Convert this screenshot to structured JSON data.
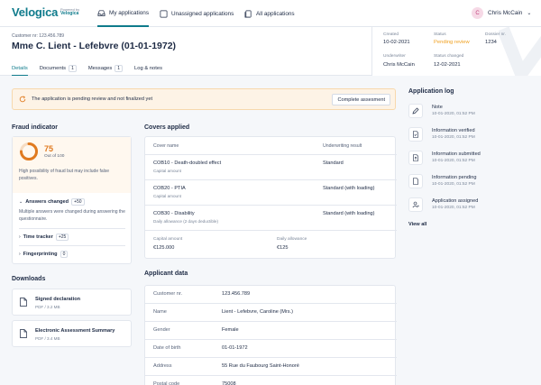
{
  "nav": {
    "brand": "Velogica",
    "powered_by": "Powered by",
    "powered_brand": "Velogica",
    "tabs": [
      {
        "label": "My applications",
        "active": true
      },
      {
        "label": "Unassigned applications",
        "active": false
      },
      {
        "label": "All applications",
        "active": false
      }
    ],
    "user": {
      "initial": "C",
      "name": "Chris McCain"
    }
  },
  "header": {
    "customer_nr": "Customer nr: 123.456.789",
    "title": "Mme C. Lient - Lefebvre (01-01-1972)",
    "tabs": [
      {
        "label": "Details",
        "badge": null,
        "active": true
      },
      {
        "label": "Documents",
        "badge": "1",
        "active": false
      },
      {
        "label": "Messages",
        "badge": "1",
        "active": false
      },
      {
        "label": "Log & notes",
        "badge": null,
        "active": false
      }
    ],
    "meta": {
      "created_label": "Created",
      "created_value": "10-02-2021",
      "status_label": "Status",
      "status_value": "Pending review",
      "dossier_label": "Dossier nr.",
      "dossier_value": "1234",
      "underwriter_label": "Underwriter",
      "underwriter_value": "Chris McCain",
      "status_changed_label": "Status changed",
      "status_changed_value": "12-02-2021"
    }
  },
  "banner": {
    "text": "The application is pending review and not finalized yet",
    "button": "Complete assesment"
  },
  "fraud": {
    "title": "Fraud indicator",
    "score": "75",
    "score_fraction": 0.75,
    "out_of": "Out of 100",
    "description": "High possibility of fraud but may include false positives.",
    "answers_changed": {
      "label": "Answers changed",
      "badge": "+50",
      "description": "Multiple answers were changed during answering the questionnaire."
    },
    "time_tracker": {
      "label": "Time tracker",
      "badge": "+25"
    },
    "fingerprinting": {
      "label": "Fingerprinting",
      "badge": "0"
    }
  },
  "downloads": {
    "title": "Downloads",
    "items": [
      {
        "name": "Signed declaration",
        "size": "PDF / 3.2 MB"
      },
      {
        "name": "Electronic Assessment Summary",
        "size": "PDF / 3.4 MB"
      }
    ]
  },
  "covers": {
    "title": "Covers applied",
    "col_name": "Cover name",
    "col_result": "Underwriting result",
    "rows": [
      {
        "name": "COB10 - Death-doubled effect",
        "detail": "Capital amount",
        "result": "Standard"
      },
      {
        "name": "COB20 - PTIA",
        "detail": "Capital amount",
        "result": "Standard (with loading)"
      },
      {
        "name": "COB30 - Disability",
        "detail": "Daily allowance (2 days deductible)",
        "result": "Standard (with loading)"
      }
    ],
    "capital_label": "Capital amount",
    "capital_value": "€125.000",
    "daily_label": "Daily allowance",
    "daily_value": "€125"
  },
  "applicant": {
    "title": "Applicant data",
    "rows": [
      {
        "key": "Customer nr.",
        "value": "123.456.789"
      },
      {
        "key": "Name",
        "value": "Lient - Lefebvre, Caroline (Mrs.)"
      },
      {
        "key": "Gender",
        "value": "Female"
      },
      {
        "key": "Date of birth",
        "value": "01-01-1972"
      },
      {
        "key": "Address",
        "value": "55 Rue du Faubourg Saint-Honoré"
      },
      {
        "key": "Postal code",
        "value": "75008"
      }
    ]
  },
  "log": {
    "title": "Application log",
    "items": [
      {
        "icon": "note-icon",
        "title": "Note",
        "date": "10-01-2020, 01:52 PM"
      },
      {
        "icon": "document-check-icon",
        "title": "Information verified",
        "date": "10-01-2020, 01:52 PM"
      },
      {
        "icon": "document-upload-icon",
        "title": "Information submitted",
        "date": "10-01-2020, 01:52 PM"
      },
      {
        "icon": "document-icon",
        "title": "Information pending",
        "date": "10-01-2020, 01:52 PM"
      },
      {
        "icon": "user-assign-icon",
        "title": "Application assigned",
        "date": "10-01-2020, 01:52 PM"
      }
    ],
    "view_all": "View all"
  },
  "colors": {
    "accent": "#0f7b8c",
    "warning": "#f0a020",
    "gauge": "#e07a1f"
  }
}
